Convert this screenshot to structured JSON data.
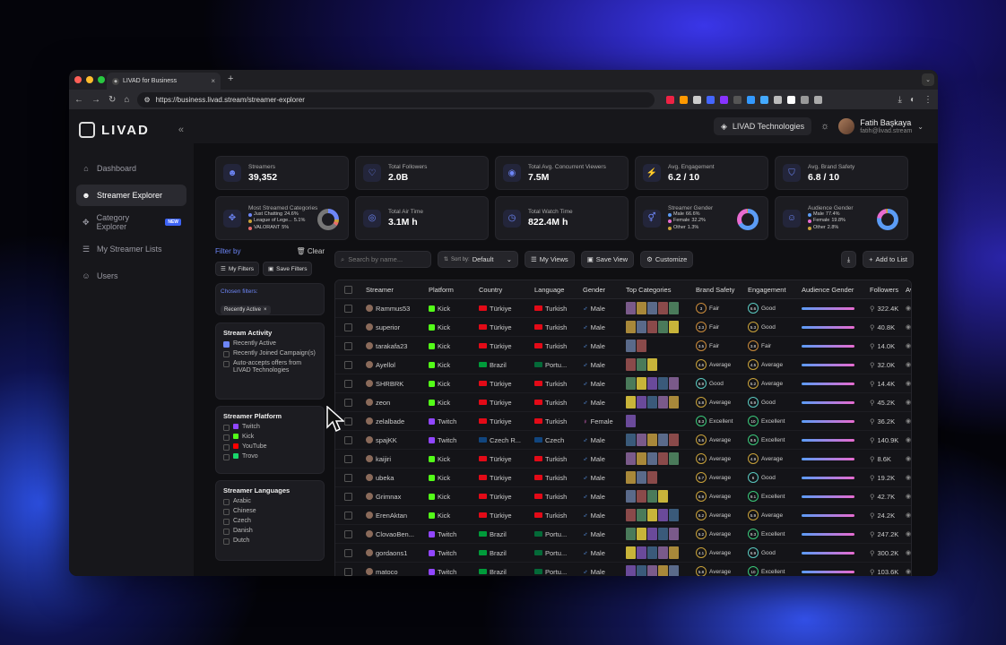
{
  "browser": {
    "tab_title": "LIVAD for Business",
    "url": "https://business.livad.stream/streamer-explorer"
  },
  "sidebar": {
    "logo": "LIVAD",
    "items": [
      {
        "label": "Dashboard",
        "icon": "home-icon",
        "active": false
      },
      {
        "label": "Streamer Explorer",
        "icon": "users-icon",
        "active": true
      },
      {
        "label": "Category Explorer",
        "icon": "gamepad-icon",
        "active": false,
        "badge": "NEW"
      },
      {
        "label": "My Streamer Lists",
        "icon": "list-icon",
        "active": false
      },
      {
        "label": "Users",
        "icon": "user-group-icon",
        "active": false
      }
    ]
  },
  "topbar": {
    "org": "LIVAD Technologies",
    "user_name": "Fatih Başkaya",
    "user_email": "fatih@livad.stream"
  },
  "stats": [
    {
      "label": "Streamers",
      "value": "39,352",
      "icon": "users-icon"
    },
    {
      "label": "Total Followers",
      "value": "2.0B",
      "icon": "heart-icon"
    },
    {
      "label": "Total Avg. Concurrent Viewers",
      "value": "7.5M",
      "icon": "eye-icon"
    },
    {
      "label": "Avg. Engagement",
      "value": "6.2 / 10",
      "icon": "bolt-icon"
    },
    {
      "label": "Avg. Brand Safety",
      "value": "6.8 / 10",
      "icon": "shield-icon"
    }
  ],
  "stats2": {
    "categories": {
      "label": "Most Streamed Categories",
      "items": [
        {
          "name": "Just Chatting",
          "pct": "24.6%"
        },
        {
          "name": "League of Lege...",
          "pct": "5.1%"
        },
        {
          "name": "VALORANT",
          "pct": "5%"
        }
      ]
    },
    "air": {
      "label": "Total Air Time",
      "value": "3.1M h"
    },
    "watch": {
      "label": "Total Watch Time",
      "value": "822.4M h"
    },
    "gender": {
      "label": "Streamer Gender",
      "items": [
        {
          "name": "Male",
          "pct": "66.6%"
        },
        {
          "name": "Female",
          "pct": "32.2%"
        },
        {
          "name": "Other",
          "pct": "1.3%"
        }
      ]
    },
    "aud": {
      "label": "Audience Gender",
      "items": [
        {
          "name": "Male",
          "pct": "77.4%"
        },
        {
          "name": "Female",
          "pct": "19.8%"
        },
        {
          "name": "Other",
          "pct": "2.8%"
        }
      ]
    }
  },
  "filters": {
    "title": "Filter by",
    "clear": "Clear",
    "my_filters": "My Filters",
    "save_filters": "Save Filters",
    "chosen_title": "Chosen filters:",
    "chosen": "Recently Active",
    "activity": {
      "title": "Stream Activity",
      "options": [
        "Recently Active",
        "Recently Joined Campaign(s)",
        "Auto-accepts offers from LIVAD Technologies"
      ]
    },
    "platform": {
      "title": "Streamer Platform",
      "options": [
        "Twitch",
        "Kick",
        "YouTube",
        "Trovo"
      ]
    },
    "languages": {
      "title": "Streamer Languages",
      "options": [
        "Arabic",
        "Chinese",
        "Czech",
        "Danish",
        "Dutch"
      ]
    }
  },
  "toolbar": {
    "search_placeholder": "Search by name...",
    "sort_label": "Sort by:",
    "sort_value": "Default",
    "my_views": "My Views",
    "save_view": "Save View",
    "customize": "Customize",
    "add_to_list": "Add to List"
  },
  "table": {
    "headers": [
      "Streamer",
      "Platform",
      "Country",
      "Language",
      "Gender",
      "Top Categories",
      "Brand Safety",
      "Engagement",
      "Audience Gender",
      "Followers",
      "Av"
    ],
    "rows": [
      {
        "name": "Rammus53",
        "platform": "Kick",
        "country": "Türkiye",
        "lang": "Turkish",
        "gender": "Male",
        "bs": "3",
        "bsl": "Fair",
        "en": "6.6",
        "enl": "Good",
        "fol": "322.4K"
      },
      {
        "name": "superior",
        "platform": "Kick",
        "country": "Türkiye",
        "lang": "Turkish",
        "gender": "Male",
        "bs": "3.3",
        "bsl": "Fair",
        "en": "5.3",
        "enl": "Good",
        "fol": "40.8K"
      },
      {
        "name": "tarakafa23",
        "platform": "Kick",
        "country": "Türkiye",
        "lang": "Turkish",
        "gender": "Male",
        "bs": "3.5",
        "bsl": "Fair",
        "en": "3.8",
        "enl": "Fair",
        "fol": "14.0K"
      },
      {
        "name": "Ayellol",
        "platform": "Kick",
        "country": "Brazil",
        "lang": "Portu...",
        "gender": "Male",
        "bs": "4.6",
        "bsl": "Average",
        "en": "4.5",
        "enl": "Average",
        "fol": "32.0K"
      },
      {
        "name": "SHRBRK",
        "platform": "Kick",
        "country": "Türkiye",
        "lang": "Turkish",
        "gender": "Male",
        "bs": "6.9",
        "bsl": "Good",
        "en": "5.2",
        "enl": "Average",
        "fol": "14.4K"
      },
      {
        "name": "zeon",
        "platform": "Kick",
        "country": "Türkiye",
        "lang": "Turkish",
        "gender": "Male",
        "bs": "5.8",
        "bsl": "Average",
        "en": "6.9",
        "enl": "Good",
        "fol": "45.2K"
      },
      {
        "name": "zelalbade",
        "platform": "Twitch",
        "country": "Türkiye",
        "lang": "Turkish",
        "gender": "Female",
        "bs": "8.3",
        "bsl": "Excellent",
        "en": "10",
        "enl": "Excellent",
        "fol": "36.2K"
      },
      {
        "name": "spajKK",
        "platform": "Twitch",
        "country": "Czech R...",
        "lang": "Czech",
        "gender": "Male",
        "bs": "5.6",
        "bsl": "Average",
        "en": "8.5",
        "enl": "Excellent",
        "fol": "140.9K"
      },
      {
        "name": "kaijiri",
        "platform": "Kick",
        "country": "Türkiye",
        "lang": "Turkish",
        "gender": "Male",
        "bs": "4.1",
        "bsl": "Average",
        "en": "4.9",
        "enl": "Average",
        "fol": "8.6K"
      },
      {
        "name": "ubeka",
        "platform": "Kick",
        "country": "Türkiye",
        "lang": "Turkish",
        "gender": "Male",
        "bs": "5.7",
        "bsl": "Average",
        "en": "6",
        "enl": "Good",
        "fol": "19.2K"
      },
      {
        "name": "Grimnax",
        "platform": "Kick",
        "country": "Türkiye",
        "lang": "Turkish",
        "gender": "Male",
        "bs": "5.9",
        "bsl": "Average",
        "en": "9.1",
        "enl": "Excellent",
        "fol": "42.7K"
      },
      {
        "name": "ErenAktan",
        "platform": "Kick",
        "country": "Türkiye",
        "lang": "Turkish",
        "gender": "Male",
        "bs": "5.2",
        "bsl": "Average",
        "en": "5.9",
        "enl": "Average",
        "fol": "24.2K"
      },
      {
        "name": "ClovaoBen...",
        "platform": "Twitch",
        "country": "Brazil",
        "lang": "Portu...",
        "gender": "Male",
        "bs": "5.2",
        "bsl": "Average",
        "en": "9.3",
        "enl": "Excellent",
        "fol": "247.2K"
      },
      {
        "name": "gordaons1",
        "platform": "Twitch",
        "country": "Brazil",
        "lang": "Portu...",
        "gender": "Male",
        "bs": "4.1",
        "bsl": "Average",
        "en": "6.9",
        "enl": "Good",
        "fol": "300.2K"
      },
      {
        "name": "matoco",
        "platform": "Twitch",
        "country": "Brazil",
        "lang": "Portu...",
        "gender": "Male",
        "bs": "5.8",
        "bsl": "Average",
        "en": "10",
        "enl": "Excellent",
        "fol": "103.6K"
      }
    ]
  },
  "colors": {
    "accent": "#6d86f7",
    "kick": "#53fc18",
    "twitch": "#9146ff",
    "youtube": "#ff0000",
    "trovo": "#19d66b"
  }
}
